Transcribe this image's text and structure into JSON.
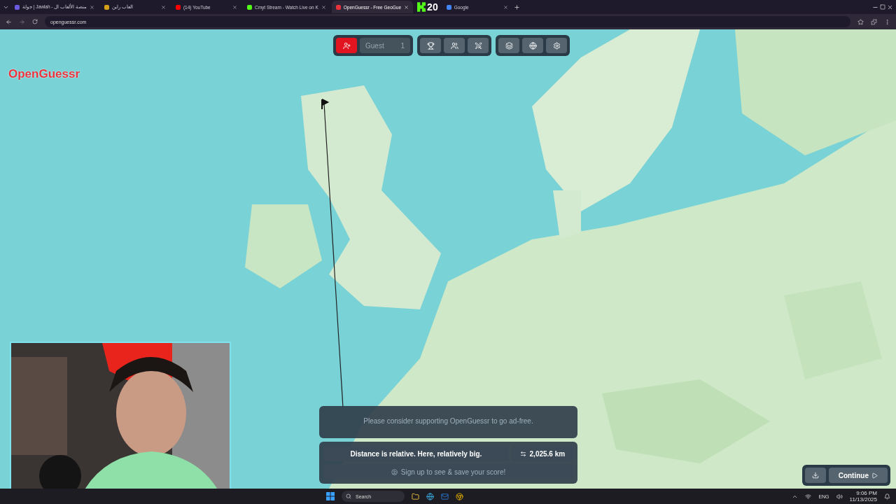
{
  "browser": {
    "tabs": [
      {
        "title": "جولة | Jawlah - منصة الألعاب ال",
        "selected": false
      },
      {
        "title": "العاب راين",
        "selected": false
      },
      {
        "title": "(14) YouTube",
        "selected": false
      },
      {
        "title": "Cmyt Stream - Watch Live on K",
        "selected": false
      },
      {
        "title": "OpenGuessr - Free GeoGue",
        "selected": true
      },
      {
        "title": "Google",
        "selected": false
      }
    ],
    "url": "openguessr.com"
  },
  "stream_overlay": {
    "count": "20"
  },
  "logo": "OpenGuessr",
  "toolbar": {
    "player": "Guest",
    "player_count": "1"
  },
  "result_panel": {
    "ad_notice": "Please consider supporting OpenGuessr to go ad-free.",
    "message": "Distance is relative. Here, relatively big.",
    "distance": "2,025.6 km",
    "signup": "Sign up to see & save your score!"
  },
  "continue_button": "Continue",
  "taskbar": {
    "search": "Search",
    "language": "ENG",
    "time": "9:06 PM",
    "date": "11/13/2025"
  }
}
